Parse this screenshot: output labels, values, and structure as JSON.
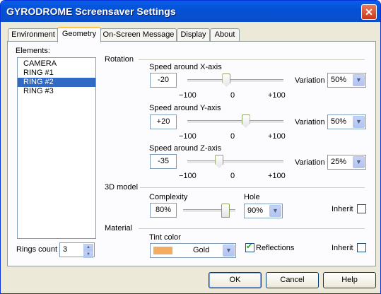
{
  "window": {
    "title": "GYRODROME Screensaver Settings",
    "close_glyph": "✕"
  },
  "tabs": [
    "Environment",
    "Geometry",
    "On-Screen Message",
    "Display",
    "About"
  ],
  "active_tab": "Geometry",
  "elements": {
    "label": "Elements:",
    "items": [
      "CAMERA",
      "RING #1",
      "RING #2",
      "RING #3"
    ],
    "selected": "RING #2"
  },
  "rings_count": {
    "label": "Rings count",
    "value": "3"
  },
  "rotation": {
    "group_label": "Rotation",
    "x": {
      "label": "Speed around X-axis",
      "value": "-20",
      "slider_value": -20,
      "variation_label": "Variation",
      "variation": "50%"
    },
    "y": {
      "label": "Speed around Y-axis",
      "value": "+20",
      "slider_value": 20,
      "variation_label": "Variation",
      "variation": "50%"
    },
    "z": {
      "label": "Speed around Z-axis",
      "value": "-35",
      "slider_value": -35,
      "variation_label": "Variation",
      "variation": "25%"
    },
    "scale": {
      "min": "−100",
      "mid": "0",
      "max": "+100"
    }
  },
  "model": {
    "group_label": "3D model",
    "complexity_label": "Complexity",
    "complexity": "80%",
    "complexity_fraction": 0.8,
    "hole_label": "Hole",
    "hole": "90%",
    "inherit_label": "Inherit",
    "inherit": false
  },
  "material": {
    "group_label": "Material",
    "tint_label": "Tint color",
    "tint": "Gold",
    "tint_color": "#f3ad62",
    "reflections_label": "Reflections",
    "reflections": true,
    "inherit_label": "Inherit",
    "inherit": false
  },
  "buttons": {
    "ok": "OK",
    "cancel": "Cancel",
    "help": "Help"
  },
  "glyphs": {
    "dropdown": "▼",
    "spin_up": "▲",
    "spin_down": "▼"
  }
}
